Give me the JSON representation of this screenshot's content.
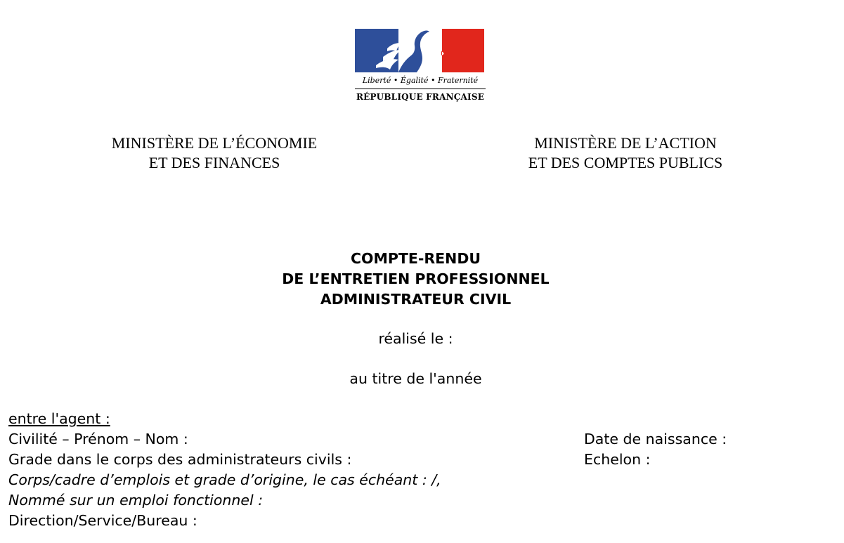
{
  "logo": {
    "motto": "Liberté • Égalité • Fraternité",
    "republic": "RÉPUBLIQUE FRANÇAISE",
    "colors": {
      "blue": "#2e4f9a",
      "red": "#e1261c"
    }
  },
  "header": {
    "ministry_left": [
      "MINISTÈRE DE L’ÉCONOMIE",
      "ET DES FINANCES"
    ],
    "ministry_right": [
      "MINISTÈRE DE L’ACTION",
      "ET DES COMPTES PUBLICS"
    ]
  },
  "title": {
    "lines": [
      "COMPTE-RENDU",
      "DE L’ENTRETIEN PROFESSIONNEL",
      "ADMINISTRATEUR CIVIL"
    ]
  },
  "meta": {
    "realise_le": "réalisé le :",
    "annee": "au titre de l'année"
  },
  "agent": {
    "heading": "entre l'agent :",
    "civilite": "Civilité – Prénom – Nom :",
    "date_naissance": "Date de naissance :",
    "grade": "Grade dans le corps des administrateurs civils :",
    "echelon": "Echelon :",
    "corps": "Corps/cadre d’emplois et grade d’origine, le cas échéant : /,",
    "emploi": "Nommé sur un emploi fonctionnel :",
    "direction": "Direction/Service/Bureau :"
  }
}
